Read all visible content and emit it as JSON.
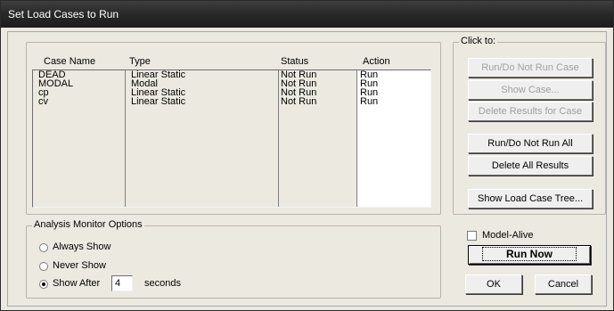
{
  "window": {
    "title": "Set Load Cases to Run"
  },
  "list": {
    "headers": {
      "case_name": "Case Name",
      "type": "Type",
      "status": "Status",
      "action": "Action"
    },
    "rows": [
      {
        "case_name": "DEAD",
        "type": "Linear Static",
        "status": "Not Run",
        "action": "Run"
      },
      {
        "case_name": "MODAL",
        "type": "Modal",
        "status": "Not Run",
        "action": "Run"
      },
      {
        "case_name": "cp",
        "type": "Linear Static",
        "status": "Not Run",
        "action": "Run"
      },
      {
        "case_name": "cv",
        "type": "Linear Static",
        "status": "Not Run",
        "action": "Run"
      }
    ]
  },
  "click_to": {
    "legend": "Click to:",
    "run_do_not_run_case": "Run/Do Not Run Case",
    "show_case": "Show Case...",
    "delete_results_for_case": "Delete Results for Case",
    "run_do_not_run_all": "Run/Do Not Run All",
    "delete_all_results": "Delete All Results",
    "show_load_case_tree": "Show Load Case Tree..."
  },
  "monitor": {
    "legend": "Analysis Monitor Options",
    "always_show": "Always Show",
    "never_show": "Never Show",
    "show_after": "Show After",
    "seconds_value": "4",
    "seconds_label": "seconds",
    "selected": "Show After"
  },
  "model_alive": {
    "label": "Model-Alive",
    "checked": false
  },
  "buttons": {
    "run_now": "Run Now",
    "ok": "OK",
    "cancel": "Cancel"
  }
}
